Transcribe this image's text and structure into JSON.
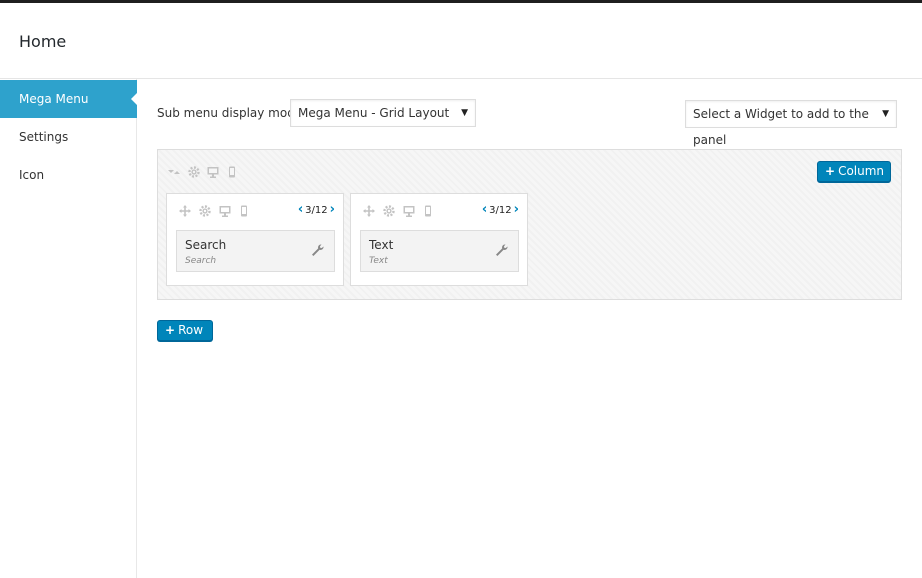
{
  "header": {
    "title": "Home"
  },
  "sidebar": {
    "items": [
      {
        "label": "Mega Menu",
        "active": true
      },
      {
        "label": "Settings",
        "active": false
      },
      {
        "label": "Icon",
        "active": false
      }
    ]
  },
  "main": {
    "display_mode_label": "Sub menu display mode",
    "display_mode_value": "Mega Menu - Grid Layout",
    "widget_select_value": "Select a Widget to add to the panel",
    "add_column_label": "Column",
    "add_row_label": "Row",
    "row": {
      "tool_icons": [
        "collapse-icon",
        "gear-icon",
        "desktop-icon",
        "mobile-icon"
      ],
      "columns": [
        {
          "size": "3/12",
          "tool_icons": [
            "move-icon",
            "gear-icon",
            "desktop-icon",
            "mobile-icon"
          ],
          "widget": {
            "title": "Search",
            "subtitle": "Search"
          }
        },
        {
          "size": "3/12",
          "tool_icons": [
            "move-icon",
            "gear-icon",
            "desktop-icon",
            "mobile-icon"
          ],
          "widget": {
            "title": "Text",
            "subtitle": "Text"
          }
        }
      ]
    }
  },
  "colors": {
    "accent": "#2ea2cc",
    "button": "#0085ba",
    "button_border": "#006799",
    "panel_bg": "#f6f6f6"
  }
}
